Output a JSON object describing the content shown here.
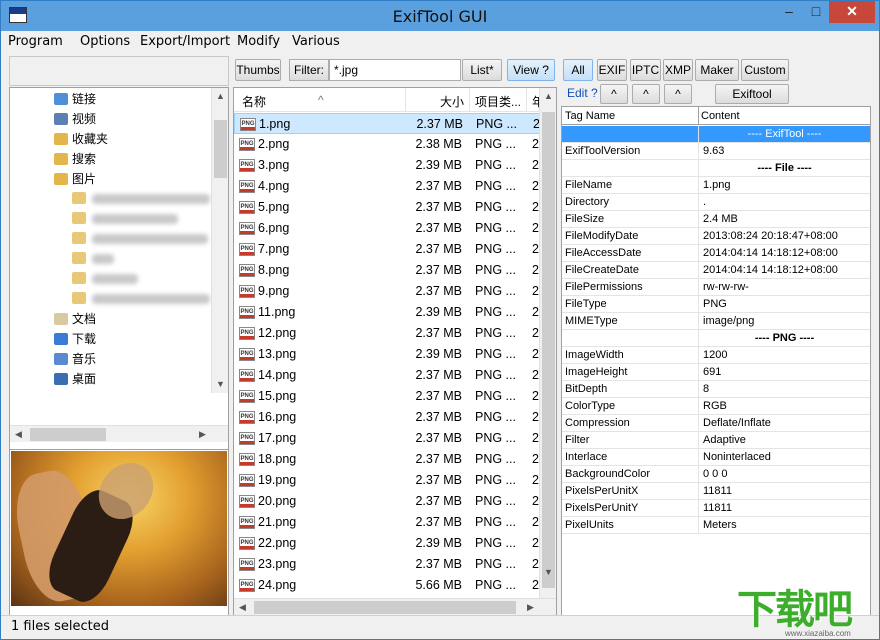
{
  "window": {
    "title": "ExifTool GUI",
    "minimize": "–",
    "maximize": "□",
    "close": "✕"
  },
  "menu": [
    "Program",
    "Options",
    "Export/Import",
    "Modify",
    "Various"
  ],
  "tree": {
    "items": [
      {
        "label": "链接",
        "icon": "link-folder-icon",
        "color": "#4e8fd6"
      },
      {
        "label": "视频",
        "icon": "video-folder-icon",
        "color": "#5c7fb5"
      },
      {
        "label": "收藏夹",
        "icon": "star-folder-icon",
        "color": "#e2b64a"
      },
      {
        "label": "搜索",
        "icon": "search-folder-icon",
        "color": "#e2b64a"
      },
      {
        "label": "图片",
        "icon": "pictures-folder-icon",
        "color": "#e2b64a"
      },
      {
        "label": "文档",
        "icon": "documents-folder-icon",
        "color": "#d8c9a0"
      },
      {
        "label": "下载",
        "icon": "downloads-folder-icon",
        "color": "#3a7bd5"
      },
      {
        "label": "音乐",
        "icon": "music-folder-icon",
        "color": "#5b8ad0"
      },
      {
        "label": "桌面",
        "icon": "desktop-folder-icon",
        "color": "#3b6db3"
      }
    ]
  },
  "toolbar_mid": {
    "thumbs": "Thumbs",
    "filter_label": "Filter:",
    "filter_value": "*.jpg",
    "list": "List*",
    "view": "View ?"
  },
  "filelist": {
    "headers": {
      "name": "名称",
      "size": "大小",
      "type": "项目类...",
      "extra": "年"
    },
    "rows": [
      {
        "name": "1.png",
        "size": "2.37 MB",
        "type": "PNG ...",
        "extra": "2"
      },
      {
        "name": "2.png",
        "size": "2.38 MB",
        "type": "PNG ...",
        "extra": "2"
      },
      {
        "name": "3.png",
        "size": "2.39 MB",
        "type": "PNG ...",
        "extra": "2"
      },
      {
        "name": "4.png",
        "size": "2.37 MB",
        "type": "PNG ...",
        "extra": "2"
      },
      {
        "name": "5.png",
        "size": "2.37 MB",
        "type": "PNG ...",
        "extra": "2"
      },
      {
        "name": "6.png",
        "size": "2.37 MB",
        "type": "PNG ...",
        "extra": "2"
      },
      {
        "name": "7.png",
        "size": "2.37 MB",
        "type": "PNG ...",
        "extra": "2"
      },
      {
        "name": "8.png",
        "size": "2.37 MB",
        "type": "PNG ...",
        "extra": "2"
      },
      {
        "name": "9.png",
        "size": "2.37 MB",
        "type": "PNG ...",
        "extra": "2"
      },
      {
        "name": "11.png",
        "size": "2.39 MB",
        "type": "PNG ...",
        "extra": "2"
      },
      {
        "name": "12.png",
        "size": "2.37 MB",
        "type": "PNG ...",
        "extra": "2"
      },
      {
        "name": "13.png",
        "size": "2.39 MB",
        "type": "PNG ...",
        "extra": "2"
      },
      {
        "name": "14.png",
        "size": "2.37 MB",
        "type": "PNG ...",
        "extra": "2"
      },
      {
        "name": "15.png",
        "size": "2.37 MB",
        "type": "PNG ...",
        "extra": "2"
      },
      {
        "name": "16.png",
        "size": "2.37 MB",
        "type": "PNG ...",
        "extra": "2"
      },
      {
        "name": "17.png",
        "size": "2.37 MB",
        "type": "PNG ...",
        "extra": "2"
      },
      {
        "name": "18.png",
        "size": "2.37 MB",
        "type": "PNG ...",
        "extra": "2"
      },
      {
        "name": "19.png",
        "size": "2.37 MB",
        "type": "PNG ...",
        "extra": "2"
      },
      {
        "name": "20.png",
        "size": "2.37 MB",
        "type": "PNG ...",
        "extra": "2"
      },
      {
        "name": "21.png",
        "size": "2.37 MB",
        "type": "PNG ...",
        "extra": "2"
      },
      {
        "name": "22.png",
        "size": "2.39 MB",
        "type": "PNG ...",
        "extra": "2"
      },
      {
        "name": "23.png",
        "size": "2.37 MB",
        "type": "PNG ...",
        "extra": "2"
      },
      {
        "name": "24.png",
        "size": "5.66 MB",
        "type": "PNG ...",
        "extra": "2"
      }
    ]
  },
  "toolbar_right": {
    "all": "All",
    "exif": "EXIF",
    "iptc": "IPTC",
    "xmp": "XMP",
    "maker": "Maker",
    "custom": "Custom",
    "edit": "Edit ?",
    "up": "^",
    "exiftool_direct": "Exiftool direct"
  },
  "tagtable": {
    "headers": {
      "tag": "Tag Name",
      "content": "Content"
    },
    "rows": [
      {
        "tag": "",
        "content": "---- ExifTool ----",
        "kind": "hl"
      },
      {
        "tag": "ExifToolVersion",
        "content": "9.63",
        "kind": ""
      },
      {
        "tag": "",
        "content": "---- File ----",
        "kind": "section"
      },
      {
        "tag": "FileName",
        "content": "1.png",
        "kind": ""
      },
      {
        "tag": "Directory",
        "content": ".",
        "kind": ""
      },
      {
        "tag": "FileSize",
        "content": "2.4 MB",
        "kind": ""
      },
      {
        "tag": "FileModifyDate",
        "content": "2013:08:24 20:18:47+08:00",
        "kind": ""
      },
      {
        "tag": "FileAccessDate",
        "content": "2014:04:14 14:18:12+08:00",
        "kind": ""
      },
      {
        "tag": "FileCreateDate",
        "content": "2014:04:14 14:18:12+08:00",
        "kind": ""
      },
      {
        "tag": "FilePermissions",
        "content": "rw-rw-rw-",
        "kind": ""
      },
      {
        "tag": "FileType",
        "content": "PNG",
        "kind": ""
      },
      {
        "tag": "MIMEType",
        "content": "image/png",
        "kind": ""
      },
      {
        "tag": "",
        "content": "---- PNG ----",
        "kind": "section"
      },
      {
        "tag": "ImageWidth",
        "content": "1200",
        "kind": ""
      },
      {
        "tag": "ImageHeight",
        "content": "691",
        "kind": ""
      },
      {
        "tag": "BitDepth",
        "content": "8",
        "kind": ""
      },
      {
        "tag": "ColorType",
        "content": "RGB",
        "kind": ""
      },
      {
        "tag": "Compression",
        "content": "Deflate/Inflate",
        "kind": ""
      },
      {
        "tag": "Filter",
        "content": "Adaptive",
        "kind": ""
      },
      {
        "tag": "Interlace",
        "content": "Noninterlaced",
        "kind": ""
      },
      {
        "tag": "BackgroundColor",
        "content": "0 0 0",
        "kind": ""
      },
      {
        "tag": "PixelsPerUnitX",
        "content": "11811",
        "kind": ""
      },
      {
        "tag": "PixelsPerUnitY",
        "content": "11811",
        "kind": ""
      },
      {
        "tag": "PixelUnits",
        "content": "Meters",
        "kind": ""
      }
    ]
  },
  "status": {
    "text": "1 files selected"
  },
  "watermark": {
    "big": "下载吧",
    "small": "www.xiazaiba.com"
  }
}
